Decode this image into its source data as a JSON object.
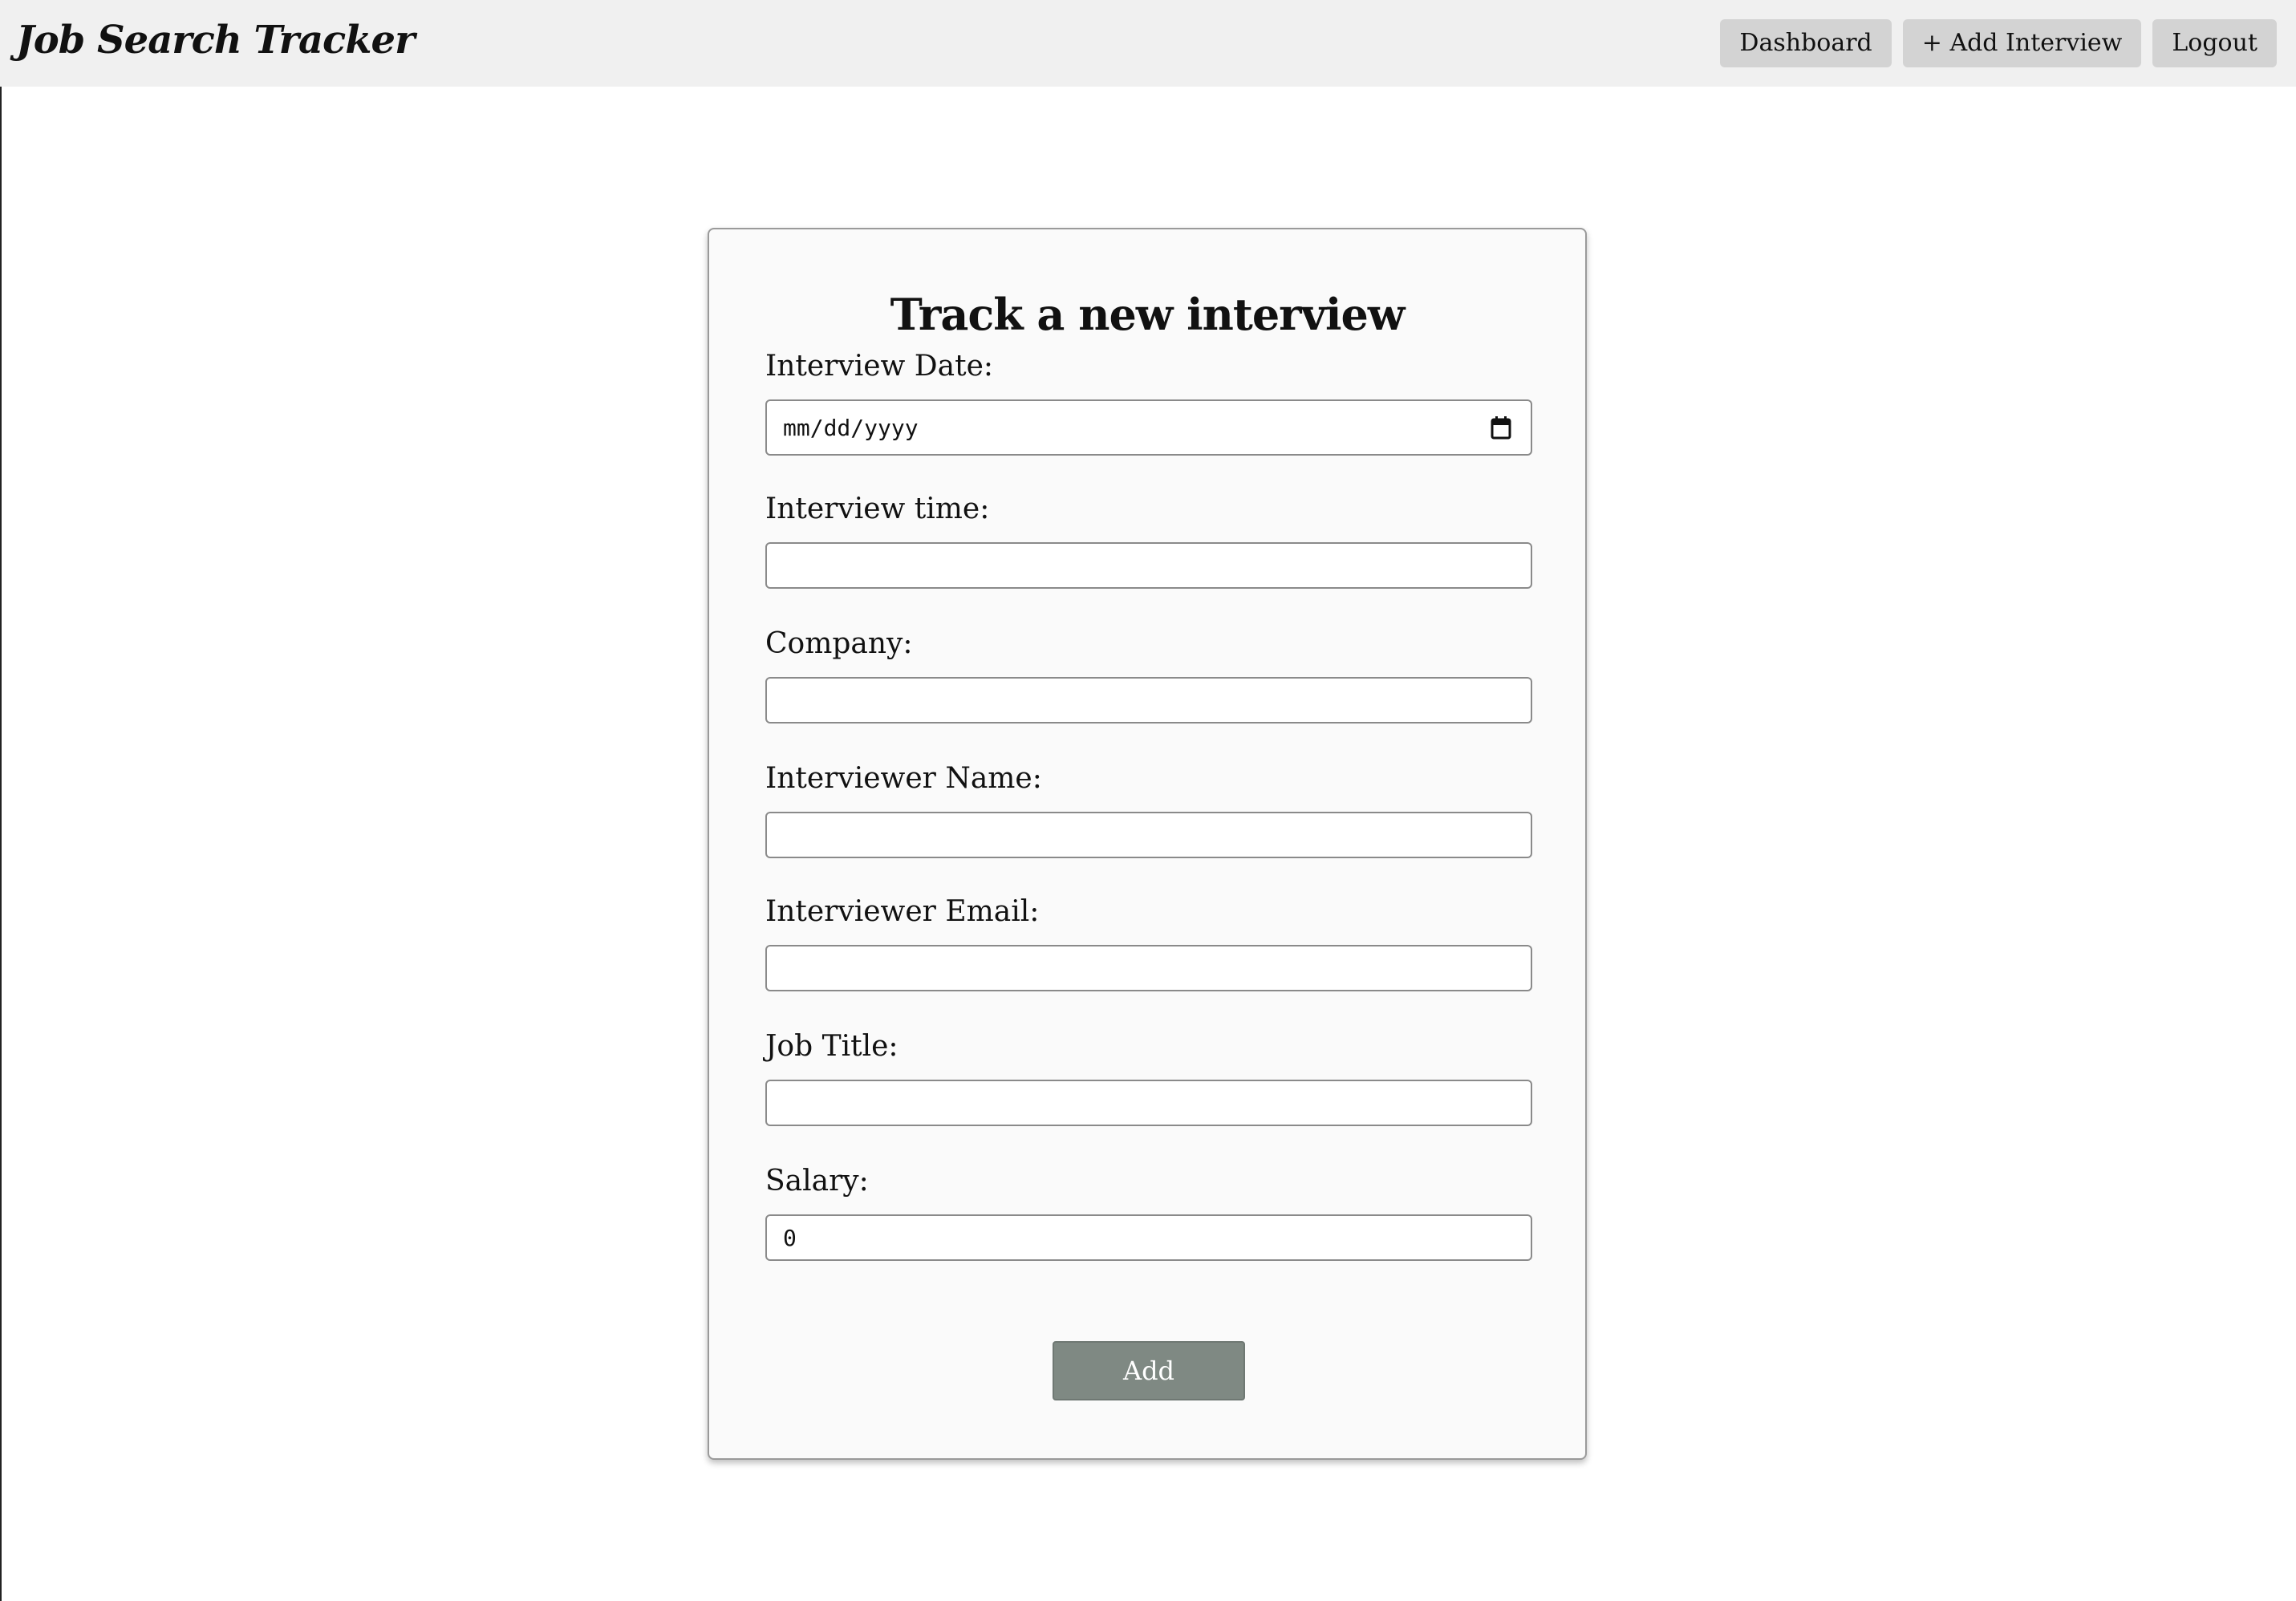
{
  "app": {
    "title": "Job Search Tracker"
  },
  "nav": {
    "dashboard_label": "Dashboard",
    "add_interview_label": "+ Add Interview",
    "logout_label": "Logout"
  },
  "form": {
    "title": "Track a new interview",
    "fields": [
      {
        "label": "Interview Date:",
        "value": "mm/dd/yyyy",
        "type": "date",
        "icon": "calendar-icon"
      },
      {
        "label": "Interview time:",
        "value": "",
        "type": "text"
      },
      {
        "label": "Company:",
        "value": "",
        "type": "text"
      },
      {
        "label": "Interviewer Name:",
        "value": "",
        "type": "text"
      },
      {
        "label": "Interviewer Email:",
        "value": "",
        "type": "text"
      },
      {
        "label": "Job Title:",
        "value": "",
        "type": "text"
      },
      {
        "label": "Salary:",
        "value": "0",
        "type": "number"
      }
    ],
    "submit_label": "Add"
  },
  "colors": {
    "topbar_bg": "#f0f0f0",
    "nav_button_bg": "#d3d3d3",
    "card_bg": "#fafafa",
    "submit_button_bg": "#7f8983"
  }
}
